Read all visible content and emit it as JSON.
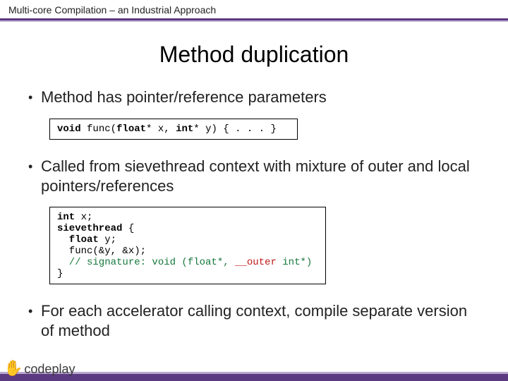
{
  "header": "Multi-core Compilation – an Industrial Approach",
  "title": "Method duplication",
  "bullets": {
    "b1": "Method has pointer/reference parameters",
    "b2": "Called from sievethread context with mixture of outer and local pointers/references",
    "b3": "For each accelerator calling context, compile separate version of method"
  },
  "code1": {
    "kw_void": "void",
    "t1": " func(",
    "kw_float": "float",
    "t2": "* x, ",
    "kw_int": "int",
    "t3": "* y) { . . . }"
  },
  "code2": {
    "l1_kw": "int",
    "l1_t": " x;",
    "l2_kw": "sievethread",
    "l2_t": " {",
    "l3_kw": "  float",
    "l3_t": " y;",
    "l4": "  func(&y, &x);",
    "l5a": "  // signature: void (float*, ",
    "l5b": "__outer",
    "l5c": " int*)",
    "l6": "}"
  },
  "logo_text": "codeplay"
}
